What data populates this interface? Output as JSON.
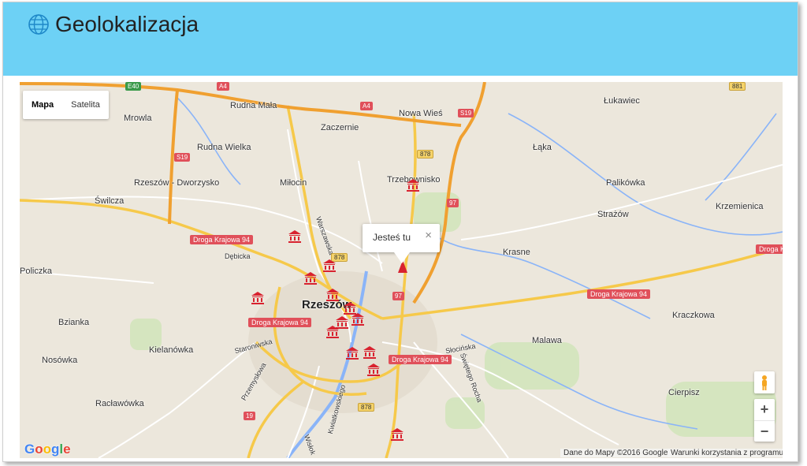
{
  "header": {
    "title": "Geolokalizacja",
    "icon": "globe-icon"
  },
  "map": {
    "type_control": {
      "map_label": "Mapa",
      "satellite_label": "Satelita",
      "active": "Mapa"
    },
    "info_window": {
      "text": "Jesteś tu",
      "close_glyph": "×"
    },
    "city": "Rzeszów",
    "places": [
      "Mrowla",
      "Rudna Mała",
      "Zaczernie",
      "Nowa Wieś",
      "Łukawiec",
      "Rudna Wielka",
      "Łąka",
      "Rzeszów - Dworzysko",
      "Miłocin",
      "Trzebownisko",
      "Palikówka",
      "Świlcza",
      "Strażów",
      "Krzemienica",
      "Krasne",
      "Policzka",
      "Bzianka",
      "Kraczkowa",
      "Kielanówka",
      "Malawa",
      "Nosówka",
      "Cierpisz",
      "Racławówka",
      "Dębicka",
      "Warszawska",
      "Staroniwska",
      "Przemysłowa",
      "Słocińska",
      "Świętego Rocha",
      "Kwiatkowskiego",
      "Wisłok"
    ],
    "road_labels": {
      "dk94": "Droga Krajowa 94",
      "s19": "S19",
      "a4": "A4",
      "e40": "E40",
      "r878": "878",
      "r97": "97",
      "r19": "19",
      "r881": "881"
    },
    "controls": {
      "pegman": "pegman-icon",
      "zoom_in": "+",
      "zoom_out": "−"
    },
    "logo": {
      "letters": [
        "G",
        "o",
        "o",
        "g",
        "l",
        "e"
      ],
      "colors": [
        "#4285f4",
        "#ea4335",
        "#fbbc05",
        "#4285f4",
        "#34a853",
        "#ea4335"
      ]
    },
    "attribution": {
      "data": "Dane do Mapy ©2016 Google",
      "terms": "Warunki korzystania z programu"
    },
    "marker_color": "#d8222f"
  }
}
